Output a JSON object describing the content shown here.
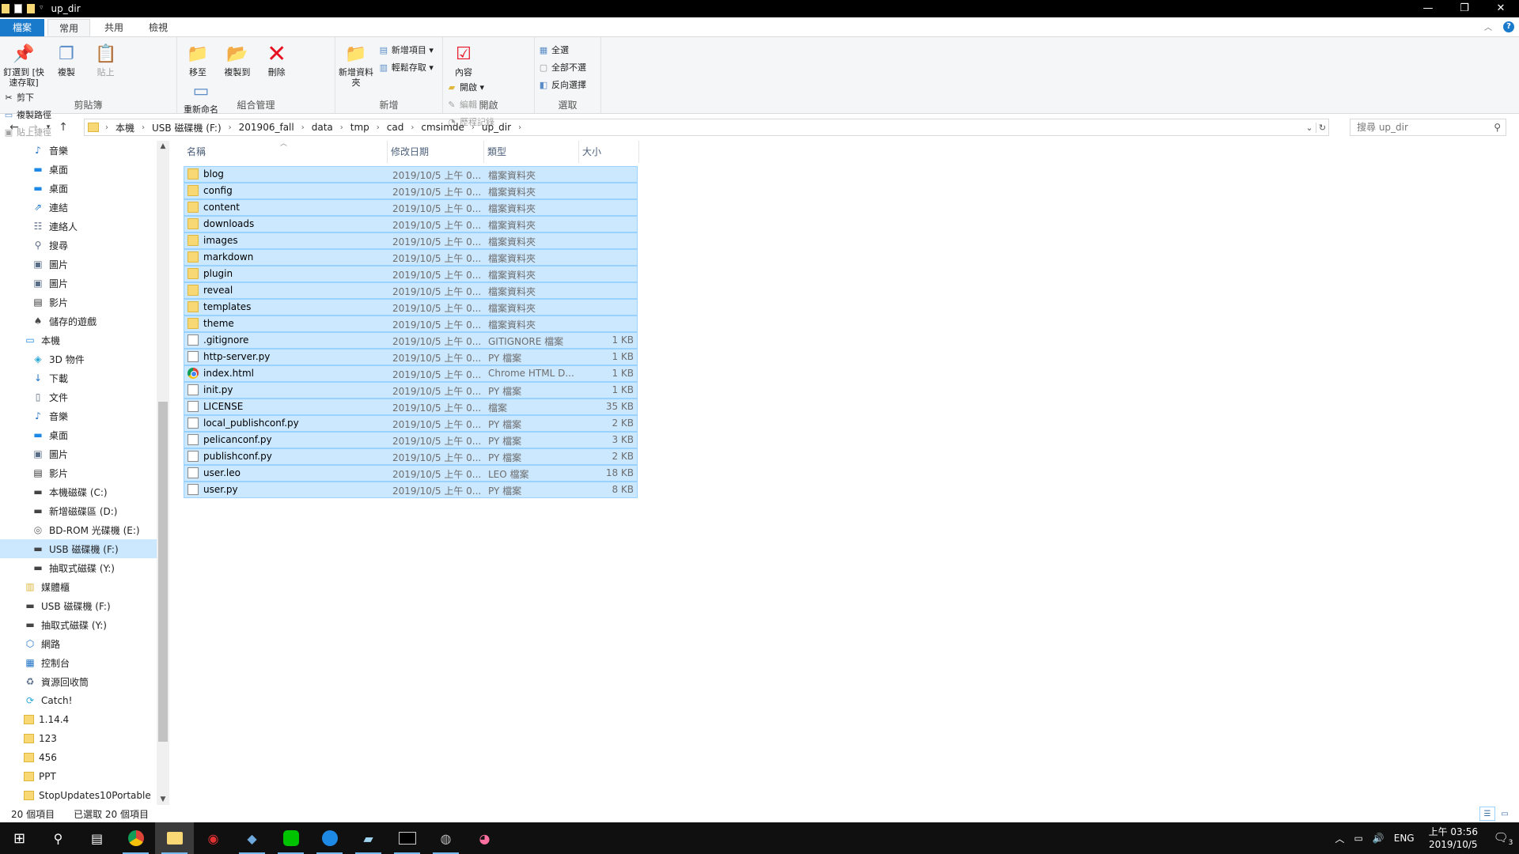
{
  "window": {
    "title": "up_dir",
    "controls": [
      "—",
      "❐",
      "✕"
    ]
  },
  "ribbon_tabs": [
    {
      "label": "檔案"
    },
    {
      "label": "常用"
    },
    {
      "label": "共用"
    },
    {
      "label": "檢視"
    }
  ],
  "ribbon": {
    "clipboard": {
      "pin_label": "釘選到 [快速存取]",
      "copy_label": "複製",
      "paste_label": "貼上",
      "cut_label": "剪下",
      "copy_path_label": "複製路徑",
      "paste_shortcut_label": "貼上捷徑",
      "group_label": "剪貼簿"
    },
    "organize": {
      "move_label": "移至",
      "copyto_label": "複製到",
      "delete_label": "刪除",
      "rename_label": "重新命名",
      "group_label": "組合管理"
    },
    "new": {
      "newfolder_label": "新增資料夾",
      "newitem_label": "新增項目",
      "easyaccess_label": "輕鬆存取",
      "group_label": "新增"
    },
    "open": {
      "properties_label": "內容",
      "open_label": "開啟",
      "edit_label": "編輯",
      "history_label": "歷程記錄",
      "group_label": "開啟"
    },
    "select": {
      "selectall_label": "全選",
      "selectnone_label": "全部不選",
      "invert_label": "反向選擇",
      "group_label": "選取"
    }
  },
  "address": {
    "crumbs": [
      "本機",
      "USB 磁碟機 (F:)",
      "201906_fall",
      "data",
      "tmp",
      "cad",
      "cmsimde",
      "up_dir"
    ],
    "search_placeholder": "搜尋 up_dir"
  },
  "navpane": {
    "items": [
      {
        "label": "音樂",
        "icon": "music-icon"
      },
      {
        "label": "桌面",
        "icon": "desktop-icon"
      },
      {
        "label": "桌面",
        "icon": "desktop-icon"
      },
      {
        "label": "連結",
        "icon": "link-icon"
      },
      {
        "label": "連絡人",
        "icon": "contacts-icon"
      },
      {
        "label": "搜尋",
        "icon": "search-icon"
      },
      {
        "label": "圖片",
        "icon": "pictures-icon"
      },
      {
        "label": "圖片",
        "icon": "pictures-icon"
      },
      {
        "label": "影片",
        "icon": "video-icon"
      },
      {
        "label": "儲存的遊戲",
        "icon": "games-icon"
      },
      {
        "label": "本機",
        "icon": "computer-icon"
      },
      {
        "label": "3D 物件",
        "icon": "3d-objects-icon"
      },
      {
        "label": "下載",
        "icon": "download-icon"
      },
      {
        "label": "文件",
        "icon": "documents-icon"
      },
      {
        "label": "音樂",
        "icon": "music-icon"
      },
      {
        "label": "桌面",
        "icon": "desktop-icon"
      },
      {
        "label": "圖片",
        "icon": "pictures-icon"
      },
      {
        "label": "影片",
        "icon": "video-icon"
      },
      {
        "label": "本機磁碟 (C:)",
        "icon": "drive-icon"
      },
      {
        "label": "新增磁碟區 (D:)",
        "icon": "drive-icon"
      },
      {
        "label": "BD-ROM 光碟機 (E:)",
        "icon": "optical-drive-icon"
      },
      {
        "label": "USB 磁碟機 (F:)",
        "icon": "usb-drive-icon"
      },
      {
        "label": "抽取式磁碟 (Y:)",
        "icon": "drive-icon"
      },
      {
        "label": "媒體櫃",
        "icon": "library-icon"
      },
      {
        "label": "USB 磁碟機 (F:)",
        "icon": "usb-drive-icon"
      },
      {
        "label": "抽取式磁碟 (Y:)",
        "icon": "drive-icon"
      },
      {
        "label": "網路",
        "icon": "network-icon"
      },
      {
        "label": "控制台",
        "icon": "control-panel-icon"
      },
      {
        "label": "資源回收筒",
        "icon": "recycle-bin-icon"
      },
      {
        "label": "Catch!",
        "icon": "catch-icon"
      },
      {
        "label": "1.14.4",
        "icon": "folder-icon"
      },
      {
        "label": "123",
        "icon": "folder-icon"
      },
      {
        "label": "456",
        "icon": "folder-icon"
      },
      {
        "label": "PPT",
        "icon": "folder-icon"
      },
      {
        "label": "StopUpdates10Portable",
        "icon": "folder-icon"
      }
    ]
  },
  "filelist": {
    "columns": {
      "name": "名稱",
      "date": "修改日期",
      "type": "類型",
      "size": "大小"
    },
    "rows": [
      {
        "name": "blog",
        "date": "2019/10/5 上午 0...",
        "type": "檔案資料夾",
        "size": "",
        "kind": "folder"
      },
      {
        "name": "config",
        "date": "2019/10/5 上午 0...",
        "type": "檔案資料夾",
        "size": "",
        "kind": "folder"
      },
      {
        "name": "content",
        "date": "2019/10/5 上午 0...",
        "type": "檔案資料夾",
        "size": "",
        "kind": "folder"
      },
      {
        "name": "downloads",
        "date": "2019/10/5 上午 0...",
        "type": "檔案資料夾",
        "size": "",
        "kind": "folder"
      },
      {
        "name": "images",
        "date": "2019/10/5 上午 0...",
        "type": "檔案資料夾",
        "size": "",
        "kind": "folder"
      },
      {
        "name": "markdown",
        "date": "2019/10/5 上午 0...",
        "type": "檔案資料夾",
        "size": "",
        "kind": "folder"
      },
      {
        "name": "plugin",
        "date": "2019/10/5 上午 0...",
        "type": "檔案資料夾",
        "size": "",
        "kind": "folder"
      },
      {
        "name": "reveal",
        "date": "2019/10/5 上午 0...",
        "type": "檔案資料夾",
        "size": "",
        "kind": "folder"
      },
      {
        "name": "templates",
        "date": "2019/10/5 上午 0...",
        "type": "檔案資料夾",
        "size": "",
        "kind": "folder"
      },
      {
        "name": "theme",
        "date": "2019/10/5 上午 0...",
        "type": "檔案資料夾",
        "size": "",
        "kind": "folder"
      },
      {
        "name": ".gitignore",
        "date": "2019/10/5 上午 0...",
        "type": "GITIGNORE 檔案",
        "size": "1 KB",
        "kind": "file"
      },
      {
        "name": "http-server.py",
        "date": "2019/10/5 上午 0...",
        "type": "PY 檔案",
        "size": "1 KB",
        "kind": "file"
      },
      {
        "name": "index.html",
        "date": "2019/10/5 上午 0...",
        "type": "Chrome HTML D...",
        "size": "1 KB",
        "kind": "chrome"
      },
      {
        "name": "init.py",
        "date": "2019/10/5 上午 0...",
        "type": "PY 檔案",
        "size": "1 KB",
        "kind": "file"
      },
      {
        "name": "LICENSE",
        "date": "2019/10/5 上午 0...",
        "type": "檔案",
        "size": "35 KB",
        "kind": "file"
      },
      {
        "name": "local_publishconf.py",
        "date": "2019/10/5 上午 0...",
        "type": "PY 檔案",
        "size": "2 KB",
        "kind": "file"
      },
      {
        "name": "pelicanconf.py",
        "date": "2019/10/5 上午 0...",
        "type": "PY 檔案",
        "size": "3 KB",
        "kind": "file"
      },
      {
        "name": "publishconf.py",
        "date": "2019/10/5 上午 0...",
        "type": "PY 檔案",
        "size": "2 KB",
        "kind": "file"
      },
      {
        "name": "user.leo",
        "date": "2019/10/5 上午 0...",
        "type": "LEO 檔案",
        "size": "18 KB",
        "kind": "file"
      },
      {
        "name": "user.py",
        "date": "2019/10/5 上午 0...",
        "type": "PY 檔案",
        "size": "8 KB",
        "kind": "file"
      }
    ]
  },
  "status": {
    "count": "20 個項目",
    "selected": "已選取 20 個項目"
  },
  "taskbar": {
    "apps": [
      "start-icon",
      "search-icon",
      "task-view-icon",
      "chrome-icon",
      "file-explorer-icon",
      "app-red-icon",
      "visual-studio-icon",
      "line-icon",
      "messenger-icon",
      "notepad-icon",
      "terminal-icon",
      "sphere-icon",
      "paint-icon"
    ],
    "lang": "ENG",
    "time": "上午 03:56",
    "date": "2019/10/5",
    "notifications": "3"
  }
}
